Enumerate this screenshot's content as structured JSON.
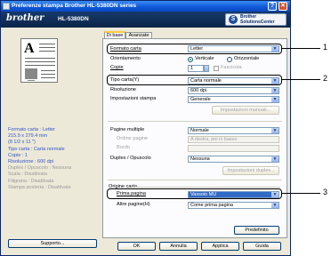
{
  "window": {
    "title": "Preferenze stampa Brother HL-5380DN series",
    "help_btn": "?",
    "close_btn": "✕"
  },
  "banner": {
    "brand": "brother",
    "model": "HL-5380DN",
    "solutions_line1": "Brother",
    "solutions_line2": "SolutionsCenter"
  },
  "preview_letter": "A",
  "summary": {
    "lines": [
      "Formato carta : Letter",
      "215.9 x 279.4 mm",
      "(8 1/2 x 11 \")",
      "Tipo carta : Carta normale",
      "Copie : 1",
      "Risoluzione : 600 dpi",
      "Duplex / Opuscolo : Nessuna",
      "Scala : Disattivata",
      "Filigrana : Disattivata",
      "Stampa posterta : Disattivata"
    ]
  },
  "support_label": "Supporto...",
  "tabs": {
    "basic": "Di base",
    "advanced": "Avanzate"
  },
  "form": {
    "paper_size_label": "Formato carta",
    "paper_size_value": "Letter",
    "orientation_label": "Orientamento",
    "orientation_vertical": "Verticale",
    "orientation_horizontal": "Orizzontale",
    "copies_label": "Copie",
    "copies_value": "1",
    "collate_label": "Fascicola",
    "media_type_label": "Tipo carta(Y)",
    "media_type_value": "Carta normale",
    "resolution_label": "Risoluzione",
    "resolution_value": "600 dpi",
    "print_settings_label": "Impostazioni stampa",
    "print_settings_value": "Generale",
    "manual_settings_btn": "Impostazioni manuali...",
    "multiple_page_label": "Pagine multiple",
    "multiple_page_value": "Normale",
    "page_order_label": "Ordine pagine",
    "page_order_value": "A destra, poi in basso",
    "border_label": "Bordo",
    "border_value": "",
    "duplex_label": "Duplex / Opuscolo",
    "duplex_value": "Nessuna",
    "duplex_settings_btn": "Impostazioni duplex...",
    "paper_source_group": "Origine carta",
    "first_page_label": "Prima pagina",
    "first_page_value": "Vassoio MU",
    "other_pages_label": "Altre pagine(H)",
    "other_pages_value": "Come prima pagina",
    "default_btn": "Predefinito"
  },
  "dialog_buttons": {
    "ok": "OK",
    "cancel": "Annulla",
    "apply": "Applica",
    "help": "Guida"
  },
  "callouts": [
    "1",
    "2",
    "3"
  ]
}
